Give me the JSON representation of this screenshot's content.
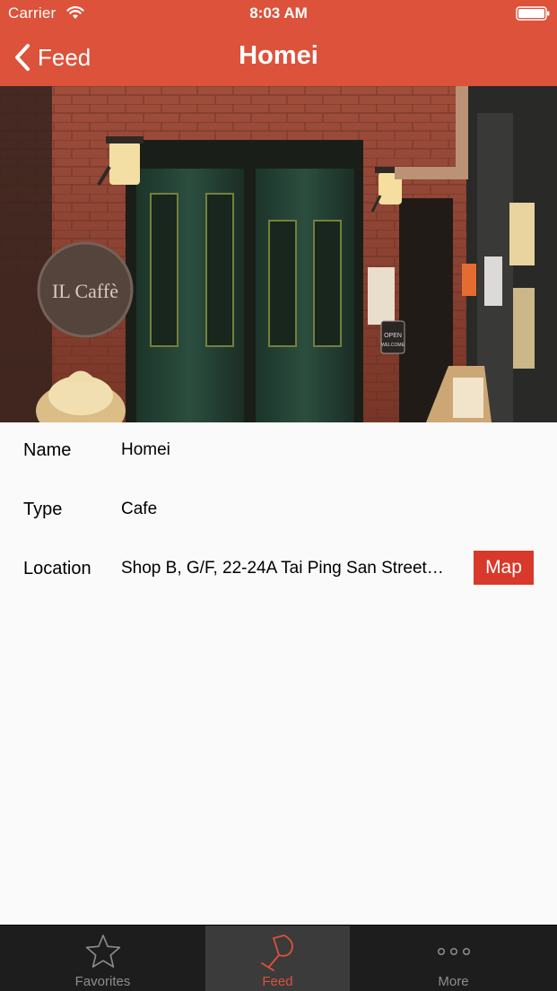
{
  "status_bar": {
    "carrier": "Carrier",
    "time": "8:03 AM",
    "icons": [
      "wifi-icon",
      "battery-icon"
    ]
  },
  "nav": {
    "back_label": "Feed",
    "title": "Homei",
    "back_icon": "chevron-left-icon"
  },
  "hero": {
    "description_icon": "restaurant-photo",
    "sign_text": "IL Caffè",
    "open_sign": "OPEN",
    "open_sign_sub": "WELCOME"
  },
  "details": {
    "rows": [
      {
        "label": "Name",
        "value": "Homei"
      },
      {
        "label": "Type",
        "value": "Cafe"
      },
      {
        "label": "Location",
        "value": "Shop B, G/F, 22-24A Tai Ping San Street…"
      }
    ],
    "map_button": "Map"
  },
  "tab_bar": {
    "tabs": [
      {
        "label": "Favorites",
        "icon": "star-icon",
        "selected": false
      },
      {
        "label": "Feed",
        "icon": "wine-glass-icon",
        "selected": true
      },
      {
        "label": "More",
        "icon": "more-dots-icon",
        "selected": false
      }
    ]
  },
  "colors": {
    "accent": "#dd523a",
    "map_button": "#d8392a",
    "tab_bar_bg": "#1d1d1d",
    "tab_selected_bg": "#3b3b3b",
    "background": "#fafafa"
  }
}
